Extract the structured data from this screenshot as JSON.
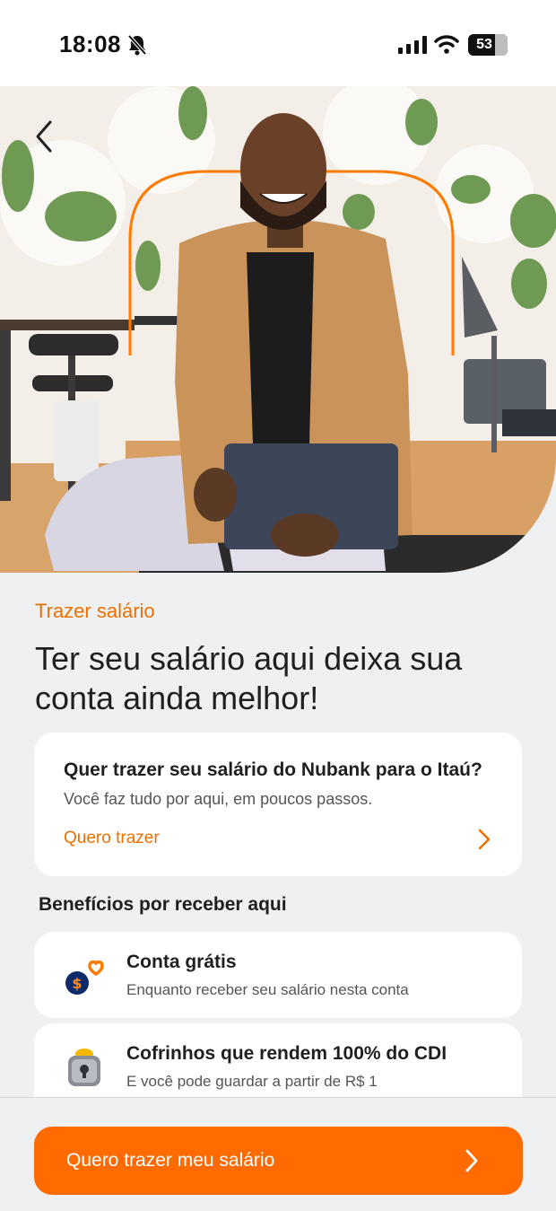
{
  "status_bar": {
    "time": "18:08",
    "battery": "53"
  },
  "hero": {
    "back_icon": "chevron-left-icon"
  },
  "intro": {
    "eyebrow": "Trazer salário",
    "headline": "Ter seu salário aqui deixa sua conta ainda melhor!"
  },
  "transfer_card": {
    "title": "Quer trazer seu salário do Nubank para o Itaú?",
    "description": "Você faz tudo por aqui, em poucos passos.",
    "link_label": "Quero trazer"
  },
  "benefits": {
    "section_title": "Benefícios por receber aqui",
    "items": [
      {
        "icon": "coin-heart-icon",
        "title": "Conta grátis",
        "description": "Enquanto receber seu salário nesta conta"
      },
      {
        "icon": "piggy-lock-icon",
        "title": "Cofrinhos que rendem 100% do CDI",
        "description": "E você pode guardar a partir de R$ 1"
      }
    ]
  },
  "cta": {
    "label": "Quero trazer meu salário"
  },
  "colors": {
    "accent": "#ec7000",
    "cta_background": "#ff6b00",
    "page_background": "#eff0f2"
  }
}
